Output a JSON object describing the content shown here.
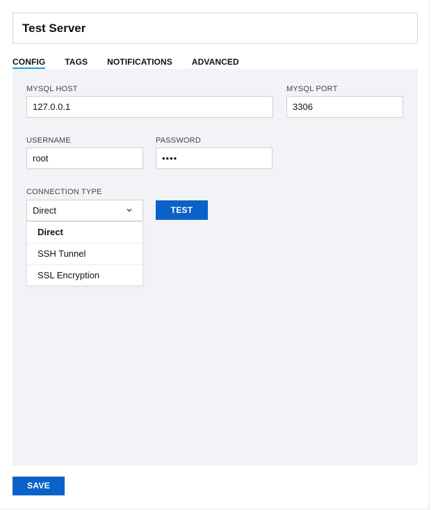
{
  "title": "Test Server",
  "tabs": [
    {
      "label": "CONFIG",
      "active": true
    },
    {
      "label": "TAGS",
      "active": false
    },
    {
      "label": "NOTIFICATIONS",
      "active": false
    },
    {
      "label": "ADVANCED",
      "active": false
    }
  ],
  "form": {
    "mysql_host": {
      "label": "MYSQL HOST",
      "value": "127.0.0.1"
    },
    "mysql_port": {
      "label": "MYSQL PORT",
      "value": "3306"
    },
    "username": {
      "label": "USERNAME",
      "value": "root"
    },
    "password": {
      "label": "PASSWORD",
      "value": "••••"
    },
    "connection_type": {
      "label": "CONNECTION TYPE",
      "value": "Direct",
      "options": [
        "Direct",
        "SSH Tunnel",
        "SSL Encryption"
      ]
    }
  },
  "buttons": {
    "test": "TEST",
    "save": "SAVE"
  },
  "colors": {
    "accent": "#0a62c9",
    "tab_underline": "#1aa0d8",
    "panel_bg": "#f2f3f6"
  }
}
